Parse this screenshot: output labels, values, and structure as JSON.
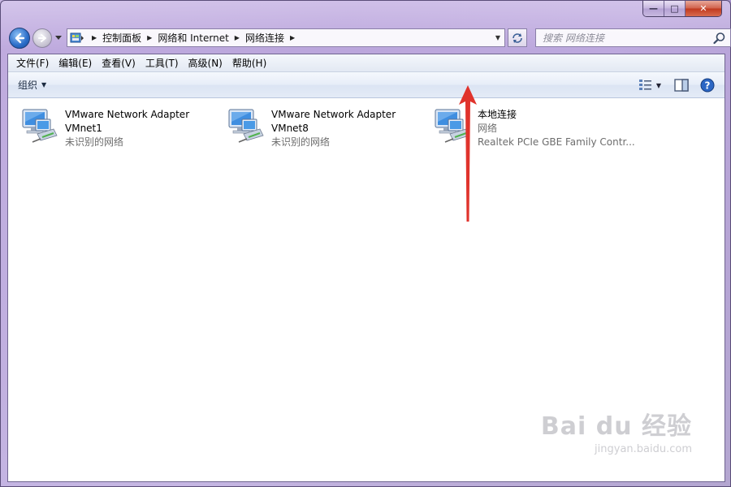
{
  "window": {
    "caption": {
      "minimize": "—",
      "maximize": "□",
      "close": "✕"
    }
  },
  "address": {
    "crumbs": [
      "控制面板",
      "网络和 Internet",
      "网络连接"
    ]
  },
  "search": {
    "placeholder": "搜索 网络连接"
  },
  "menubar": {
    "items": [
      "文件(F)",
      "编辑(E)",
      "查看(V)",
      "工具(T)",
      "高级(N)",
      "帮助(H)"
    ]
  },
  "toolbar": {
    "organize_label": "组织"
  },
  "connections": [
    {
      "name": "VMware Network Adapter",
      "name2": "VMnet1",
      "status": "未识别的网络"
    },
    {
      "name": "VMware Network Adapter",
      "name2": "VMnet8",
      "status": "未识别的网络"
    },
    {
      "name": "本地连接",
      "name2": "网络",
      "status": "Realtek PCIe GBE Family Contr..."
    }
  ],
  "watermark": {
    "main": "Bai du 经验",
    "sub": "jingyan.baidu.com"
  },
  "colors": {
    "annotation_arrow": "#e0332c",
    "accent": "#2a6cc8"
  }
}
